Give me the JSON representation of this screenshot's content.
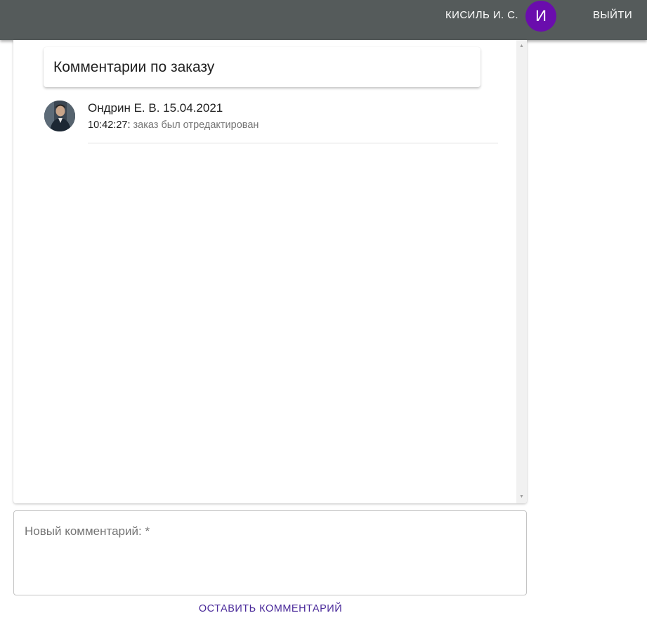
{
  "header": {
    "user_name": "КИСИЛЬ И. С.",
    "avatar_letter": "И",
    "logout_label": "ВЫЙТИ",
    "bar_color": "#555b5b",
    "avatar_color": "#6a0dad"
  },
  "comments_panel": {
    "title": "Комментарии по заказу",
    "comments": [
      {
        "author_date": "Ондрин Е. В. 15.04.2021",
        "time": "10:42:27:",
        "text": "заказ был отредактирован",
        "avatar_icon": "user-photo"
      }
    ]
  },
  "new_comment": {
    "label": "Новый комментарий: *",
    "value": ""
  },
  "submit_label": "ОСТАВИТЬ КОММЕНТАРИЙ",
  "accent_color": "#4a2a9a"
}
